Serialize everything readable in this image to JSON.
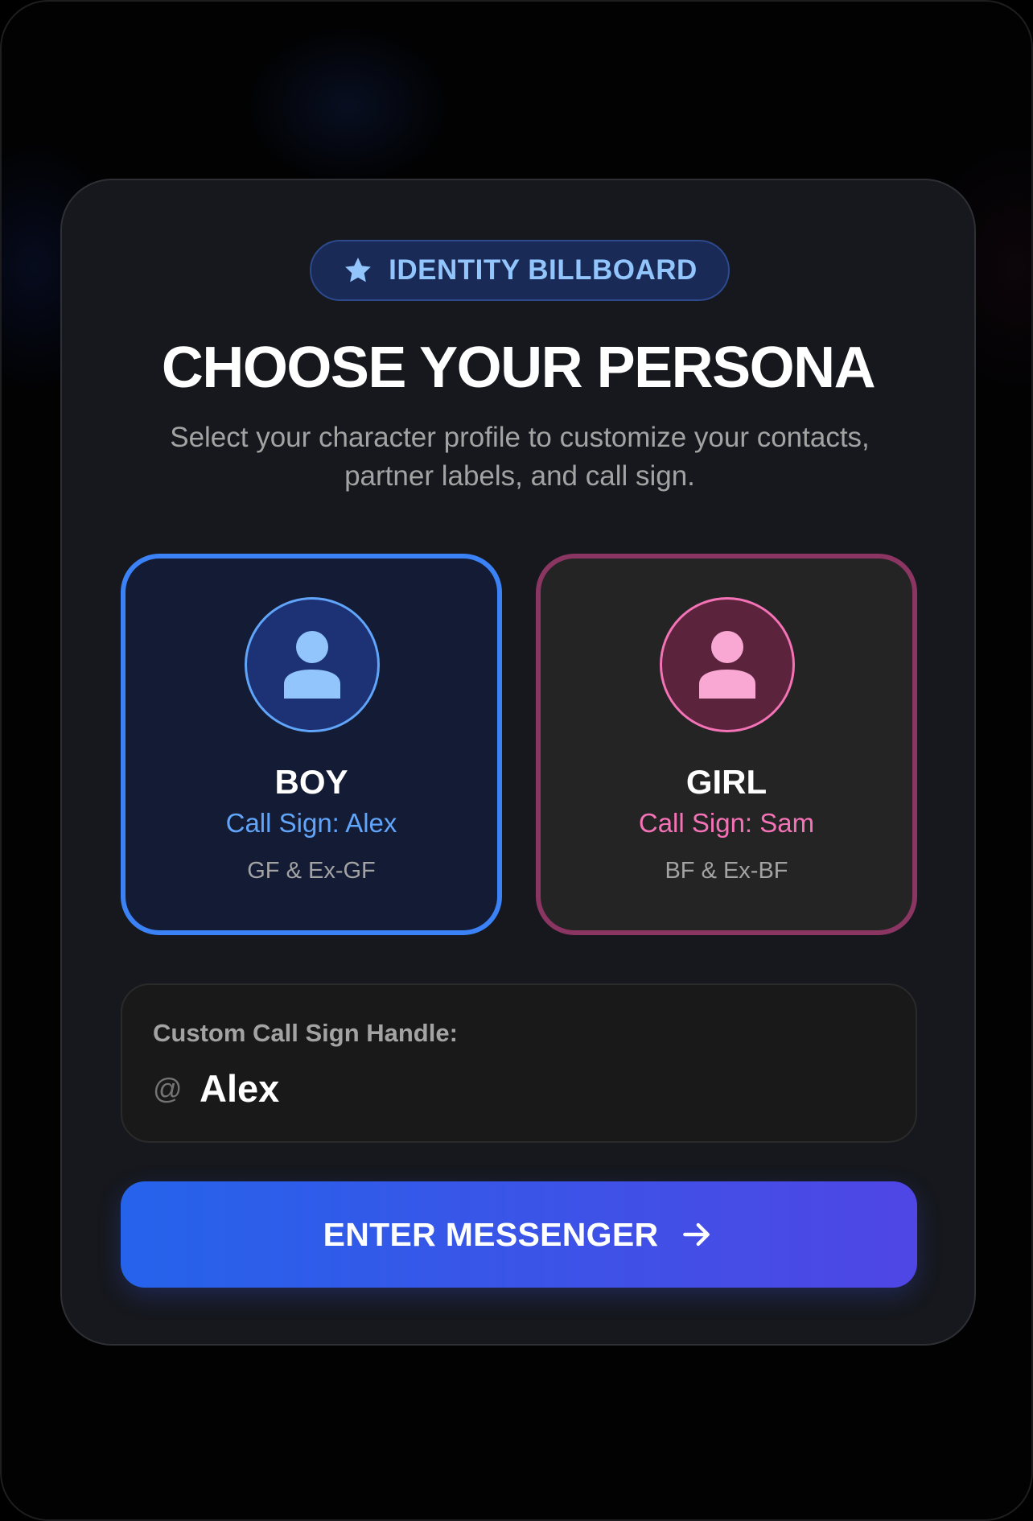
{
  "badge": {
    "label": "IDENTITY BILLBOARD",
    "icon": "star-icon"
  },
  "header": {
    "title": "CHOOSE YOUR PERSONA",
    "subtitle": "Select your character profile to customize your contacts, partner labels, and call sign."
  },
  "personas": [
    {
      "name": "BOY",
      "call_sign": "Call Sign: Alex",
      "partners": "GF & Ex-GF",
      "accent": "#3b82f6",
      "selected": true,
      "icon": "user-icon"
    },
    {
      "name": "GIRL",
      "call_sign": "Call Sign: Sam",
      "partners": "BF & Ex-BF",
      "accent": "#f472b6",
      "selected": false,
      "icon": "user-icon"
    }
  ],
  "handle": {
    "label": "Custom Call Sign Handle:",
    "prefix": "@",
    "value": "Alex"
  },
  "enter_button": {
    "label": "ENTER MESSENGER",
    "icon": "arrow-right-icon"
  },
  "colors": {
    "background": "#000000",
    "card": "#16181d",
    "accent_blue": "#3b82f6",
    "accent_pink": "#f472b6",
    "button_start": "#2563eb",
    "button_end": "#4f46e5"
  }
}
